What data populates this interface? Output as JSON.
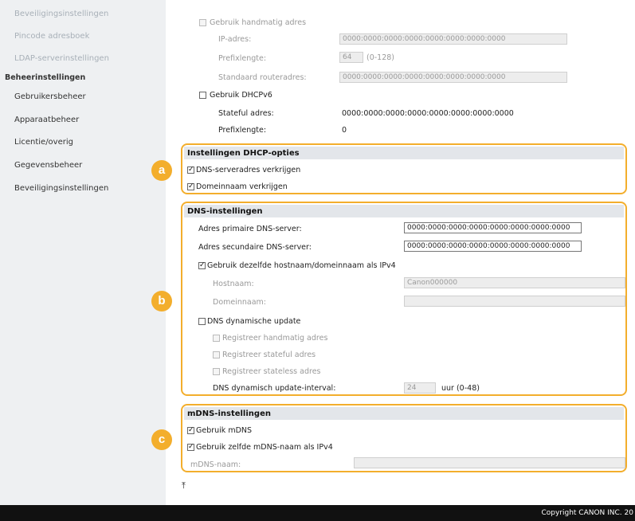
{
  "sidebar": {
    "items_top": [
      "Beveiligingsinstellingen",
      "Pincode adresboek",
      "LDAP-serverinstellingen"
    ],
    "group": "Beheerinstellingen",
    "items": [
      "Gebruikersbeheer",
      "Apparaatbeheer",
      "Licentie/overig",
      "Gegevensbeheer",
      "Beveiligingsinstellingen"
    ]
  },
  "ipv6": {
    "manual_label": "Gebruik handmatig adres",
    "ip_label": "IP-adres:",
    "ip_value": "0000:0000:0000:0000:0000:0000:0000:0000",
    "prefix_label": "Prefixlengte:",
    "prefix_value": "64",
    "prefix_range": "(0-128)",
    "router_label": "Standaard routeradres:",
    "router_value": "0000:0000:0000:0000:0000:0000:0000:0000",
    "dhcpv6_label": "Gebruik DHCPv6",
    "stateful_label": "Stateful adres:",
    "stateful_value": "0000:0000:0000:0000:0000:0000:0000:0000",
    "prefix2_label": "Prefixlengte:",
    "prefix2_value": "0"
  },
  "dhcp": {
    "title": "Instellingen DHCP-opties",
    "dns_server_label": "DNS-serveradres verkrijgen",
    "domain_label": "Domeinnaam verkrijgen"
  },
  "dns": {
    "title": "DNS-instellingen",
    "primary_label": "Adres primaire DNS-server:",
    "primary_value": "0000:0000:0000:0000:0000:0000:0000:0000",
    "secondary_label": "Adres secundaire DNS-server:",
    "secondary_value": "0000:0000:0000:0000:0000:0000:0000:0000",
    "same_host_label": "Gebruik dezelfde hostnaam/domeinnaam als IPv4",
    "hostname_label": "Hostnaam:",
    "hostname_value": "Canon000000",
    "domainname_label": "Domeinnaam:",
    "domainname_value": "",
    "dyn_update_label": "DNS dynamische update",
    "reg_manual_label": "Registreer handmatig adres",
    "reg_stateful_label": "Registreer stateful adres",
    "reg_stateless_label": "Registreer stateless adres",
    "interval_label": "DNS dynamisch update-interval:",
    "interval_value": "24",
    "interval_unit": "uur (0-48)"
  },
  "mdns": {
    "title": "mDNS-instellingen",
    "use_label": "Gebruik mDNS",
    "same_name_label": "Gebruik zelfde mDNS-naam als IPv4",
    "name_label": "mDNS-naam:",
    "name_value": ""
  },
  "badges": {
    "a": "a",
    "b": "b",
    "c": "c"
  },
  "footer": {
    "copyright": "Copyright CANON INC. 20"
  },
  "colors": {
    "accent": "#f3ae2c",
    "sidebar_bg": "#eef0f2",
    "section_head": "#e3e6ea",
    "footer_bg": "#111111"
  }
}
